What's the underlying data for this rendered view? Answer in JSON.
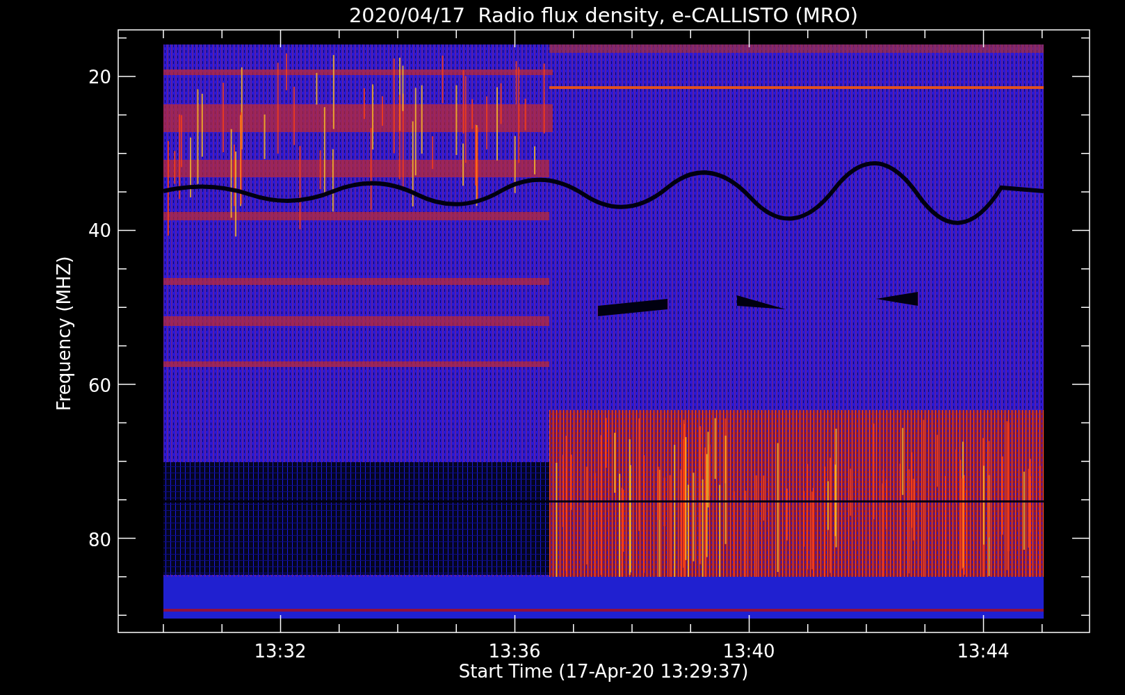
{
  "title": "2020/04/17  Radio flux density, e-CALLISTO (MRO)",
  "y_axis": {
    "label": "Frequency (MHZ)",
    "ticks": [
      "20",
      "40",
      "60",
      "80"
    ]
  },
  "x_axis": {
    "label": "Start Time (17-Apr-20 13:29:37)",
    "ticks": [
      "13:32",
      "13:36",
      "13:40",
      "13:44"
    ]
  }
}
